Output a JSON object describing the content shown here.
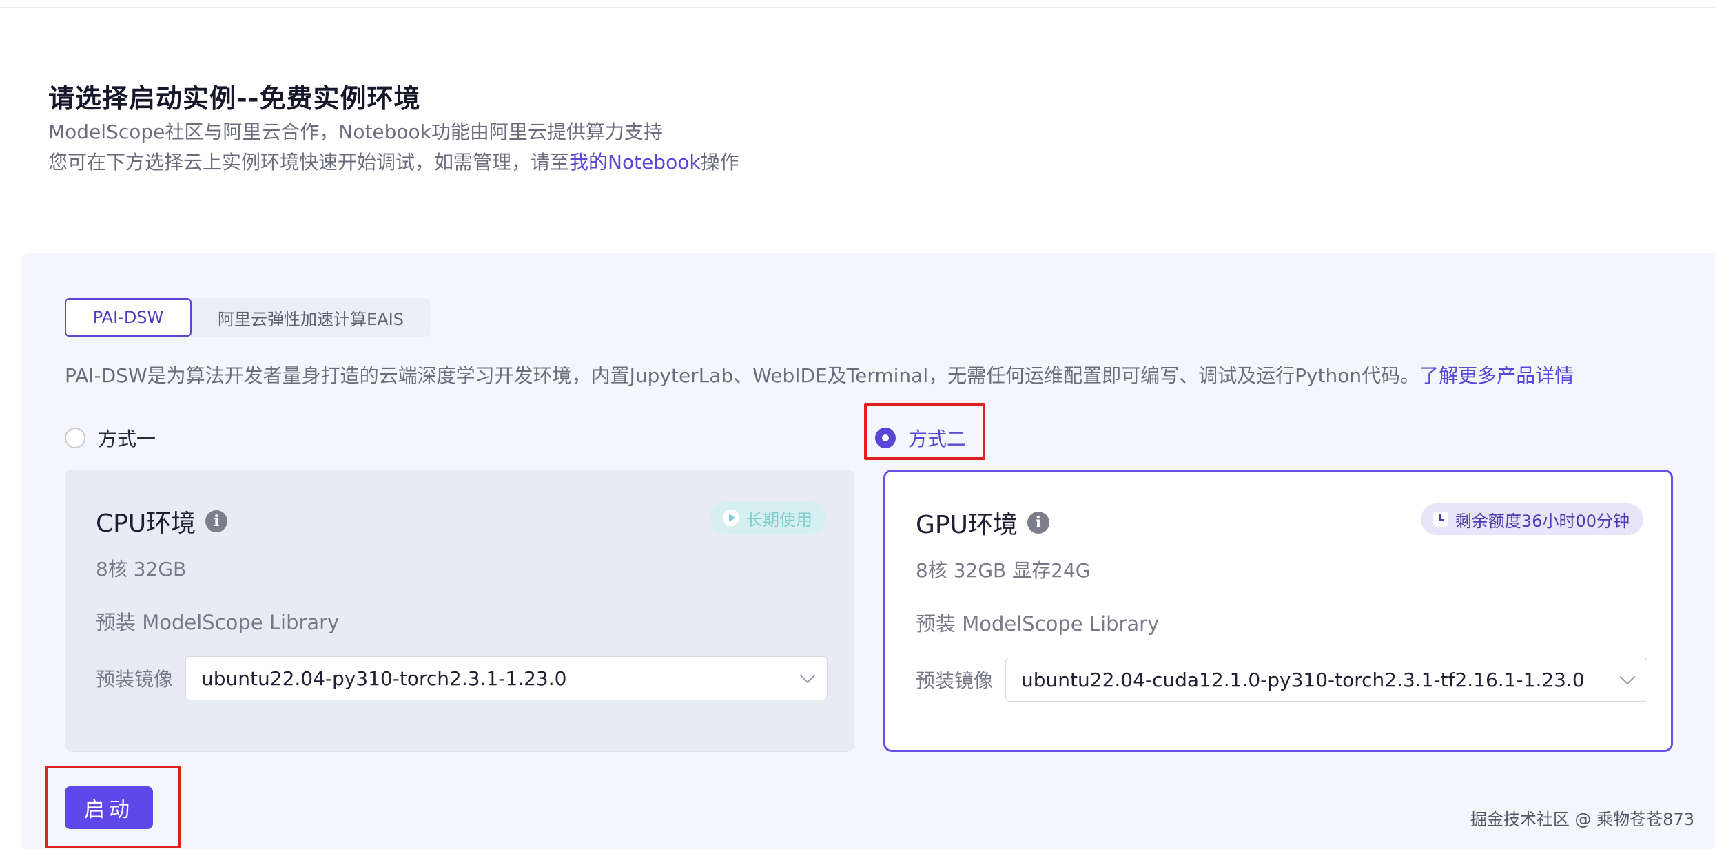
{
  "header": {
    "title": "请选择启动实例--免费实例环境",
    "line1": "ModelScope社区与阿里云合作，Notebook功能由阿里云提供算力支持",
    "line2_prefix": "您可在下方选择云上实例环境快速开始调试，如需管理，请至",
    "line2_link": "我的Notebook",
    "line2_suffix": "操作"
  },
  "tabs": [
    {
      "label": "PAI-DSW",
      "active": true
    },
    {
      "label": "阿里云弹性加速计算EAIS",
      "active": false
    }
  ],
  "description": {
    "text": "PAI-DSW是为算法开发者量身打造的云端深度学习开发环境，内置JupyterLab、WebIDE及Terminal，无需任何运维配置即可编写、调试及运行Python代码。",
    "link": "了解更多产品详情"
  },
  "options": [
    {
      "label": "方式一",
      "checked": false
    },
    {
      "label": "方式二",
      "checked": true
    }
  ],
  "cpu_card": {
    "title": "CPU环境",
    "badge": "长期使用",
    "spec": "8核 32GB",
    "library": "预装 ModelScope Library",
    "image_label": "预装镜像",
    "image_value": "ubuntu22.04-py310-torch2.3.1-1.23.0"
  },
  "gpu_card": {
    "title": "GPU环境",
    "badge": "剩余额度36小时00分钟",
    "spec": "8核 32GB 显存24G",
    "library": "预装 ModelScope Library",
    "image_label": "预装镜像",
    "image_value": "ubuntu22.04-cuda12.1.0-py310-torch2.3.1-tf2.16.1-1.23.0"
  },
  "start_button": "启动",
  "watermark": "掘金技术社区 @ 乘物苍苍873",
  "colors": {
    "accent": "#5b47d6",
    "highlight": "#e0201e"
  }
}
